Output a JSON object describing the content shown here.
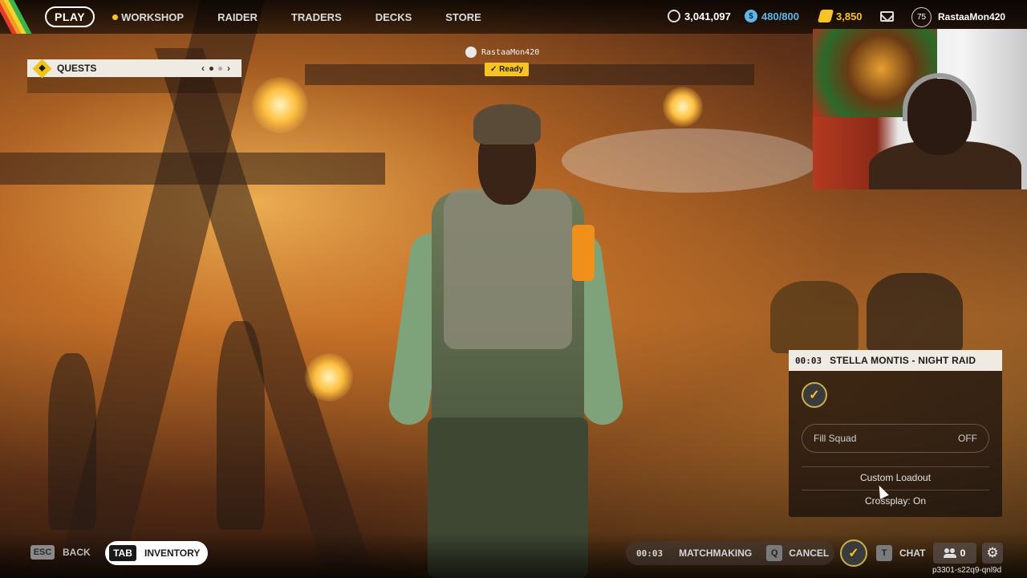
{
  "topbar": {
    "play": "PLAY",
    "nav": [
      "WORKSHOP",
      "RAIDER",
      "TRADERS",
      "DECKS",
      "STORE"
    ],
    "currency_main": "3,041,097",
    "currency_cred": "480/800",
    "currency_gold": "3,850",
    "level": "75",
    "username": "RastaaMon420"
  },
  "quests": {
    "title": "QUESTS",
    "prev": "‹",
    "next": "›"
  },
  "player": {
    "name": "RastaaMon420",
    "ready": "✓ Ready"
  },
  "match": {
    "time": "00:03",
    "title": "STELLA MONTIS - NIGHT RAID",
    "fill_squad_label": "Fill Squad",
    "fill_squad_value": "OFF",
    "custom_loadout": "Custom Loadout",
    "crossplay": "Crossplay: On"
  },
  "bottombar": {
    "back_key": "ESC",
    "back_label": "BACK",
    "inventory_key": "TAB",
    "inventory_label": "INVENTORY",
    "mm_time": "00:03",
    "mm_label": "MATCHMAKING",
    "cancel_key": "Q",
    "cancel_label": "CANCEL",
    "chat_key": "T",
    "chat_label": "CHAT",
    "friends_count": "0",
    "session_id": "p3301-s22q9-qnl9d"
  },
  "colors": {
    "accent_yellow": "#f6c325",
    "panel_light": "#f0ebe2",
    "cred_blue": "#5fb8e8"
  },
  "icons": [
    "rainbow-stripes-icon",
    "coin-icon",
    "cred-icon",
    "gold-icon",
    "mail-icon",
    "quest-diamond-icon",
    "squad-emblem-icon",
    "friends-icon",
    "gear-icon"
  ]
}
